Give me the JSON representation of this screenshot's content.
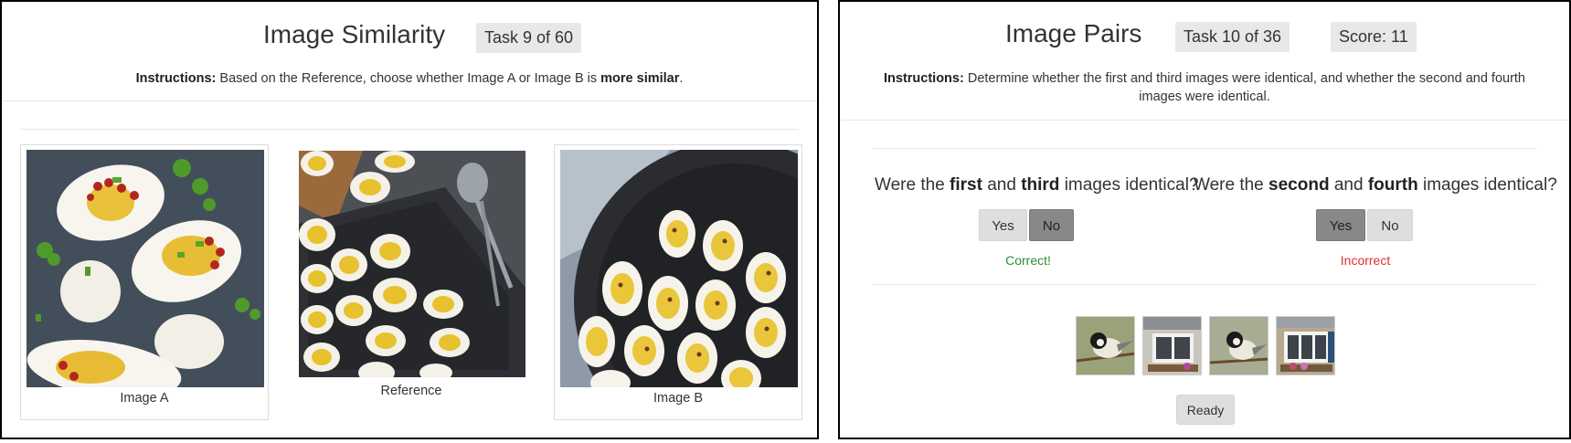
{
  "similarity": {
    "title": "Image Similarity",
    "task_badge": "Task 9 of 60",
    "instructions_bold": "Instructions:",
    "instructions_text": " Based on the Reference, choose whether Image A or Image B is ",
    "instructions_emphasis": "more similar",
    "instructions_end": ".",
    "images": [
      {
        "caption": "Image A"
      },
      {
        "caption": "Reference"
      },
      {
        "caption": "Image B"
      }
    ]
  },
  "pairs": {
    "title": "Image Pairs",
    "task_badge": "Task 10 of 36",
    "score_badge": "Score: 11",
    "instructions_bold": "Instructions:",
    "instructions_text": " Determine whether the first and third images were identical, and whether the second and fourth images were identical.",
    "q1": {
      "pre": "Were the ",
      "b1": "first",
      "mid": " and ",
      "b2": "third",
      "post": " images identical?"
    },
    "q2": {
      "pre": "Were the ",
      "b1": "second",
      "mid": " and ",
      "b2": "fourth",
      "post": " images identical?"
    },
    "yes_label": "Yes",
    "no_label": "No",
    "q1_selected": "No",
    "q2_selected": "Yes",
    "q1_feedback": "Correct!",
    "q2_feedback": "Incorrect",
    "ready_label": "Ready"
  },
  "colors": {
    "correct": "#2e8b2e",
    "incorrect": "#e0302a",
    "badge_bg": "#e8e8e8",
    "selected_btn": "#888888"
  }
}
